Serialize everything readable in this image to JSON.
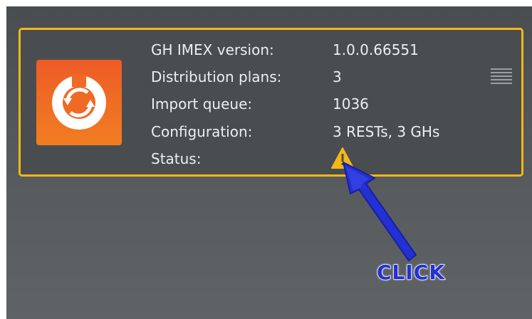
{
  "card": {
    "accent_color": "#f5b716",
    "app_icon": "gh-imex-sync-icon",
    "rows": [
      {
        "label": "GH IMEX version:",
        "value": "1.0.0.66551"
      },
      {
        "label": "Distribution plans:",
        "value": "3"
      },
      {
        "label": "Import queue:",
        "value": "1036"
      },
      {
        "label": "Configuration:",
        "value": "3 RESTs, 3 GHs"
      },
      {
        "label": "Status:",
        "value": ""
      }
    ],
    "status_icon": "warning-icon",
    "menu_icon": "hamburger-menu-icon"
  },
  "annotation": {
    "text": "CLICK",
    "color": "#2330d4"
  }
}
